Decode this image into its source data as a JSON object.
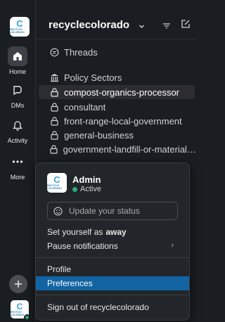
{
  "workspace": {
    "logo_text": "C",
    "logo_subtext": "RECYCLE COLORADO",
    "name": "recyclecolorado"
  },
  "rail": {
    "home_label": "Home",
    "dms_label": "DMs",
    "activity_label": "Activity",
    "more_label": "More"
  },
  "sidebar": {
    "threads_label": "Threads",
    "policy_sectors_label": "Policy Sectors",
    "channels": [
      "compost-organics-processor",
      "consultant",
      "front-range-local-government",
      "general-business",
      "government-landfill-or-material-rec..."
    ],
    "selected_channel": "compost-organics-processor"
  },
  "menu": {
    "user_name": "Admin",
    "user_status": "Active",
    "status_placeholder": "Update your status",
    "set_away_prefix": "Set yourself as",
    "set_away_word": "away",
    "pause_notifications": "Pause notifications",
    "pause_arrow": "›",
    "profile": "Profile",
    "preferences": "Preferences",
    "sign_out": "Sign out of recyclecolorado"
  },
  "colors": {
    "background": "#1a1d21",
    "highlight": "#1264a3",
    "presence": "#2bac76",
    "logo_blue": "#3aa3d8"
  }
}
